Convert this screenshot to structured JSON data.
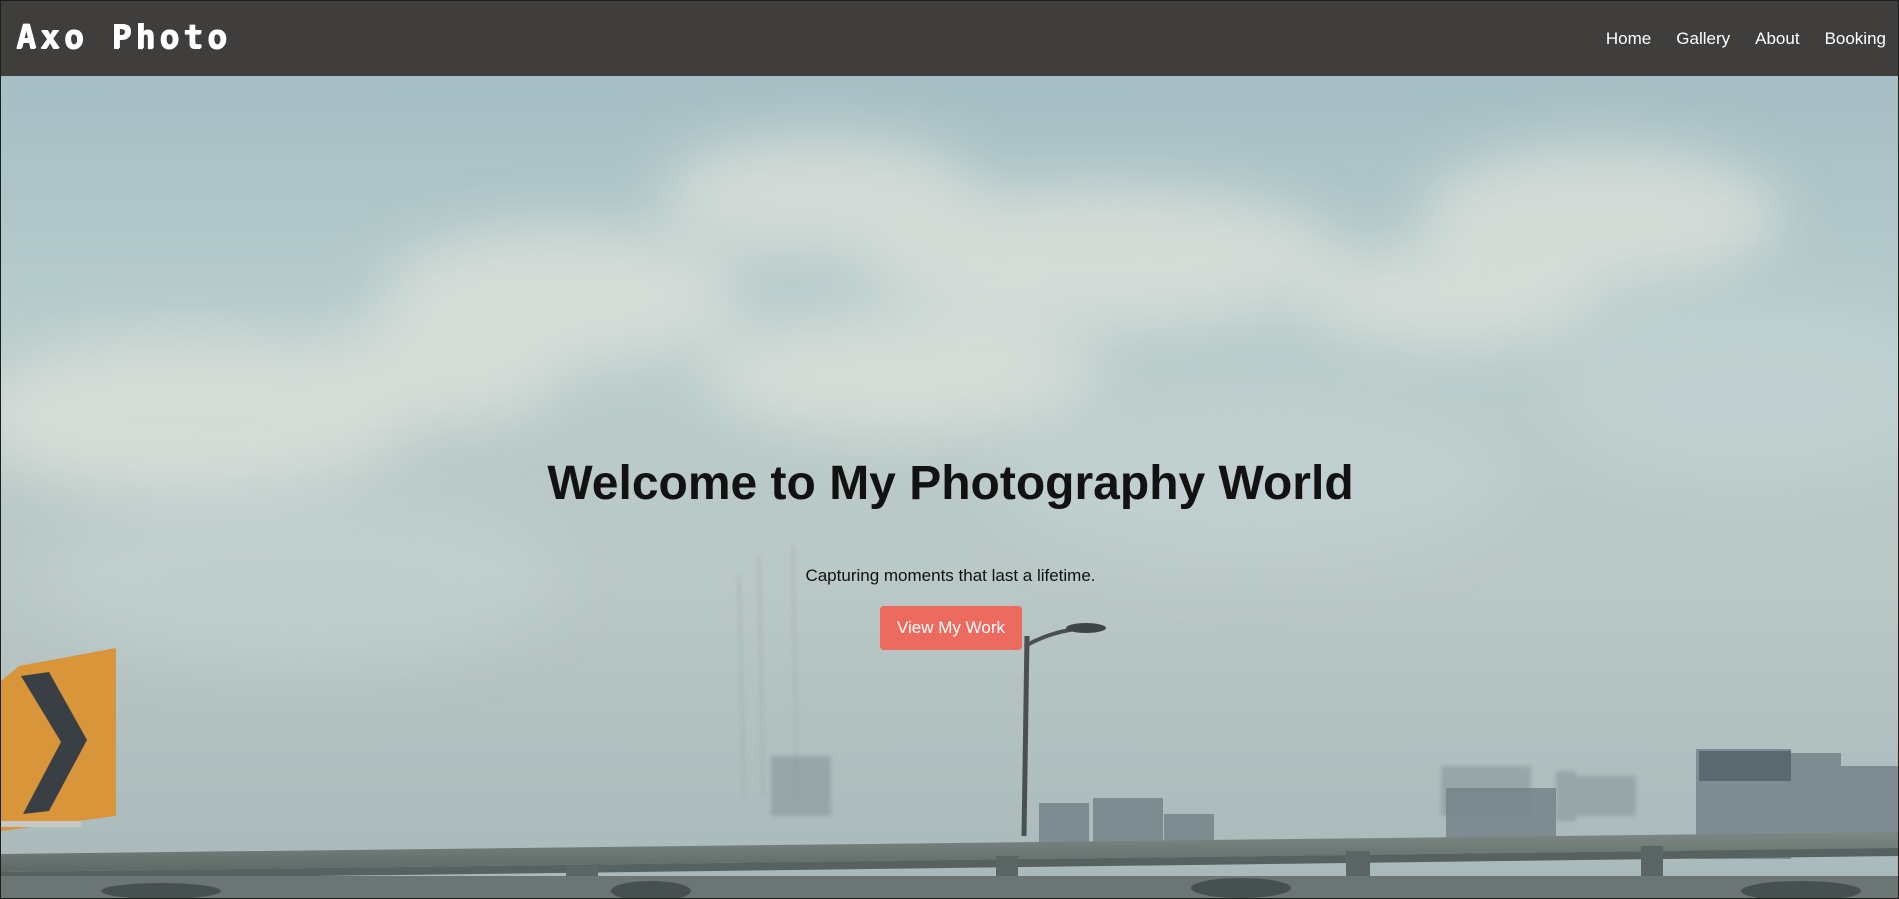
{
  "nav": {
    "logo": "Axo Photo",
    "links": [
      "Home",
      "Gallery",
      "About",
      "Booking"
    ]
  },
  "hero": {
    "title": "Welcome to My Photography World",
    "subtitle": "Capturing moments that last a lifetime.",
    "cta_label": "View My Work",
    "background_icon": "hazy-city-skyline-photo"
  },
  "colors": {
    "navbar": "#403e3c",
    "accent": "#ec6a5e",
    "nav_text": "#ffffff",
    "hero_text": "#121212"
  }
}
